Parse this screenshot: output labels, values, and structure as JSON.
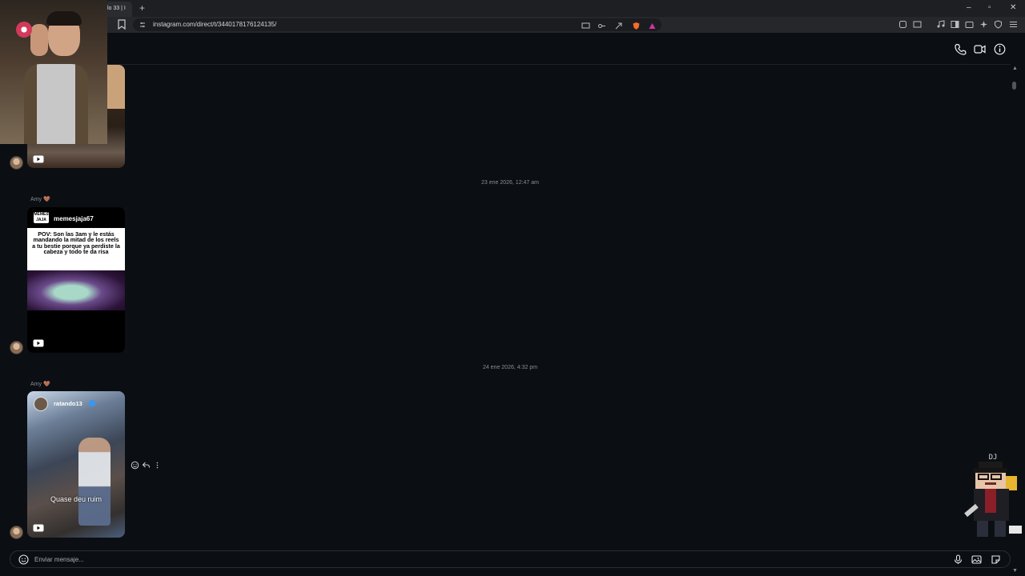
{
  "browser": {
    "tab_title": "lo 33 | I",
    "new_tab": "+",
    "url": "instagram.com/direct/t/3440178176124135/",
    "window": {
      "minimize": "–",
      "maximize": "▫",
      "close": "✕"
    }
  },
  "thread": {
    "header_icons": [
      "phone-icon",
      "video-call-icon",
      "info-icon"
    ],
    "timestamps": [
      "23 ene 2026, 12:47 am",
      "24 ene 2026, 4:32 pm"
    ],
    "messages": [
      {
        "sender": "",
        "type": "reel"
      },
      {
        "sender": "Amy 🤎",
        "type": "reel",
        "logo_text": "MEMES JAJA",
        "username": "memesjaja67",
        "caption": "POV: Son las 3am y le estás mandando la mitad de los reels a tu bestie porque ya perdiste la cabeza y todo te da risa"
      },
      {
        "sender": "Amy 🤎",
        "type": "reel",
        "username": "ratando13",
        "caption": "Quase deu ruim"
      }
    ]
  },
  "composer": {
    "placeholder": "Enviar mensaje..."
  },
  "overlay": {
    "pixel_label": "DJ"
  },
  "colors": {
    "background": "#0b0f13",
    "text": "#e4e6eb",
    "muted": "#8a8d91"
  }
}
